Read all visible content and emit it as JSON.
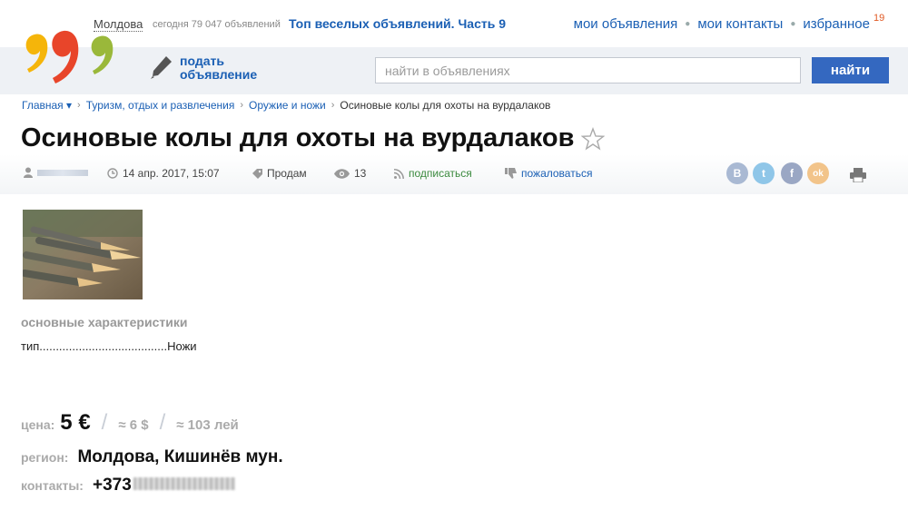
{
  "header": {
    "region": "Молдова",
    "today_count": "сегодня 79 047 объявлений",
    "top_fun": "Топ веселых объявлений. Часть 9",
    "nav": {
      "my_ads": "мои объявления",
      "my_contacts": "мои контакты",
      "favorites": "избранное",
      "favorites_count": "19"
    },
    "post_ad_line1": "подать",
    "post_ad_line2": "объявление",
    "search_placeholder": "найти в объявлениях",
    "search_button": "найти"
  },
  "breadcrumb": {
    "home": "Главная ▾",
    "cat1": "Туризм, отдых и развлечения",
    "cat2": "Оружие и ножи",
    "current": "Осиновые колы для охоты на вурдалаков"
  },
  "ad": {
    "title": "Осиновые колы для охоты на вурдалаков",
    "date": "14 апр. 2017, 15:07",
    "type": "Продам",
    "views": "13",
    "subscribe": "подписаться",
    "complain": "пожаловаться",
    "characteristics_title": "основные характеристики",
    "char_row": "тип.......................................Ножи",
    "price_label": "цена:",
    "price": "5 €",
    "price_usd": "≈ 6 $",
    "price_lei": "≈ 103 лей",
    "region_label": "регион:",
    "region": "Молдова, Кишинёв мун.",
    "contacts_label": "контакты:",
    "phone_prefix": "+373"
  },
  "share": {
    "vk": "B",
    "twitter": "t",
    "facebook": "f",
    "ok": "ok"
  },
  "colors": {
    "accent": "#1a5fb4",
    "button": "#3468c0",
    "logo_yellow": "#f5b50a",
    "logo_red": "#e8452a",
    "logo_green": "#9ab83a"
  }
}
